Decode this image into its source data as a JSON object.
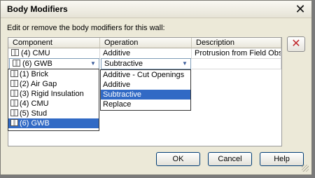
{
  "window": {
    "title": "Body Modifiers",
    "close_glyph": "✕"
  },
  "prompt": "Edit or remove the body modifiers for this wall:",
  "table": {
    "columns": [
      "Component",
      "Operation",
      "Description"
    ],
    "rows": [
      {
        "component": "(4) CMU",
        "operation": "Additive",
        "description": "Protrusion from Field Obse..."
      },
      {
        "component": "(6) GWB",
        "operation": "Subtractive",
        "description": ""
      }
    ]
  },
  "component_dropdown": {
    "options": [
      "(1) Brick",
      "(2) Air Gap",
      "(3) Rigid Insulation",
      "(4) CMU",
      "(5) Stud",
      "(6) GWB"
    ],
    "selected_index": 5
  },
  "operation_dropdown": {
    "options": [
      "Additive - Cut Openings",
      "Additive",
      "Subtractive",
      "Replace"
    ],
    "selected_index": 2
  },
  "delete_button": {
    "glyph": "✕",
    "icon": "delete-x-icon",
    "color": "#c0282d"
  },
  "buttons": {
    "ok": "OK",
    "cancel": "Cancel",
    "help": "Help"
  },
  "colors": {
    "selection": "#316ac5",
    "dialog_bg": "#ece9d8"
  }
}
